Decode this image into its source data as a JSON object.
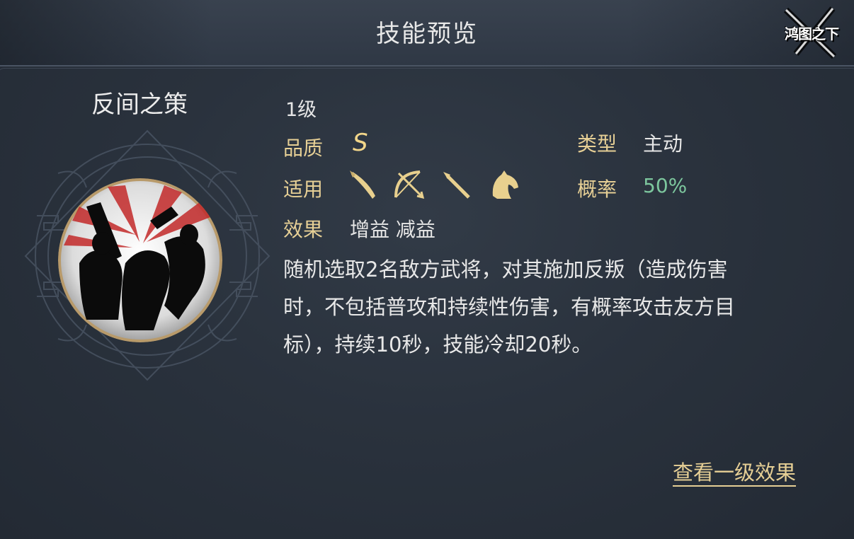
{
  "header": {
    "title": "技能预览",
    "logo_text": "鸿图之下"
  },
  "skill": {
    "name": "反间之策",
    "icon": "skill-emblem-icon",
    "level": "1级",
    "quality_label": "品质",
    "quality_value": "S",
    "type_label": "类型",
    "type_value": "主动",
    "applicable_label": "适用",
    "applicable_units": [
      "sword-icon",
      "bow-icon",
      "spear-icon",
      "horse-icon"
    ],
    "rate_label": "概率",
    "rate_value": "50%",
    "effect_label": "效果",
    "effect_value": "增益 减益",
    "description_lines": [
      "随机选取2名敌方武将，对其施加反叛（造成伤害",
      "时，不包括普攻和持续性伤害，有概率攻击友方目",
      "标），持续10秒，技能冷却20秒。"
    ]
  },
  "actions": {
    "view_level1": "查看一级效果"
  },
  "colors": {
    "label": "#e6cf95",
    "quality": "#f2d68a",
    "rate": "#7dc79e",
    "text": "#e8e8e8"
  }
}
